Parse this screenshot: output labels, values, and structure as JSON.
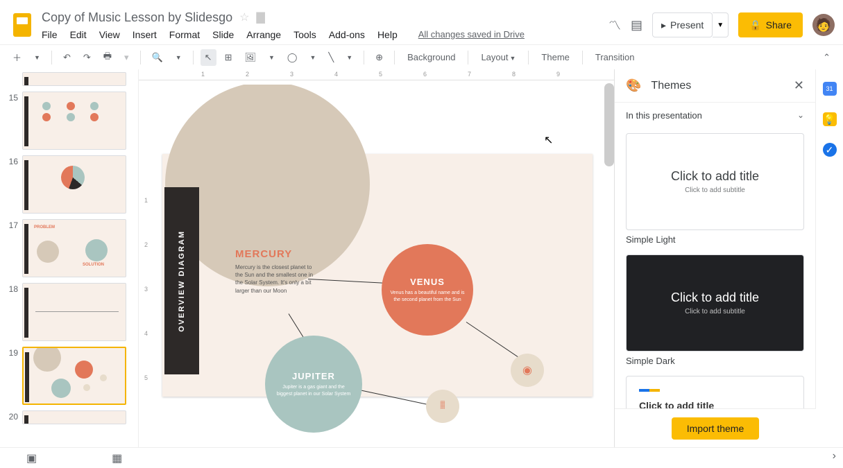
{
  "header": {
    "doc_title": "Copy of Music Lesson by Slidesgo",
    "saved_status": "All changes saved in Drive",
    "menu": {
      "file": "File",
      "edit": "Edit",
      "view": "View",
      "insert": "Insert",
      "format": "Format",
      "slide": "Slide",
      "arrange": "Arrange",
      "tools": "Tools",
      "addons": "Add-ons",
      "help": "Help"
    },
    "present": "Present",
    "share": "Share"
  },
  "toolbar": {
    "background": "Background",
    "layout": "Layout",
    "theme": "Theme",
    "transition": "Transition"
  },
  "thumbs": {
    "n15": "15",
    "n16": "16",
    "n17": "17",
    "n18": "18",
    "n19": "19",
    "n20": "20"
  },
  "slide": {
    "sidebar_label": "OVERVIEW DIAGRAM",
    "mercury_title": "MERCURY",
    "mercury_text": "Mercury is the closest planet to the Sun and the smallest one in the Solar System. It's only a bit larger than our Moon",
    "venus_title": "VENUS",
    "venus_text": "Venus has a beautiful name and is the second planet from the Sun",
    "jupiter_title": "JUPITER",
    "jupiter_text": "Jupiter is a gas giant and the biggest planet in our Solar System"
  },
  "themes": {
    "panel_title": "Themes",
    "section": "In this presentation",
    "preview_title": "Click to add title",
    "preview_sub": "Click to add subtitle",
    "simple_light": "Simple Light",
    "simple_dark": "Simple Dark",
    "import": "Import theme"
  },
  "rail": {
    "calendar_day": "31"
  },
  "ruler": {
    "r1": "1",
    "r2": "2",
    "r3": "3",
    "r4": "4",
    "r5": "5",
    "r6": "6",
    "r7": "7",
    "r8": "8",
    "r9": "9"
  },
  "ruler_v": {
    "v1": "1",
    "v2": "2",
    "v3": "3",
    "v4": "4",
    "v5": "5"
  }
}
